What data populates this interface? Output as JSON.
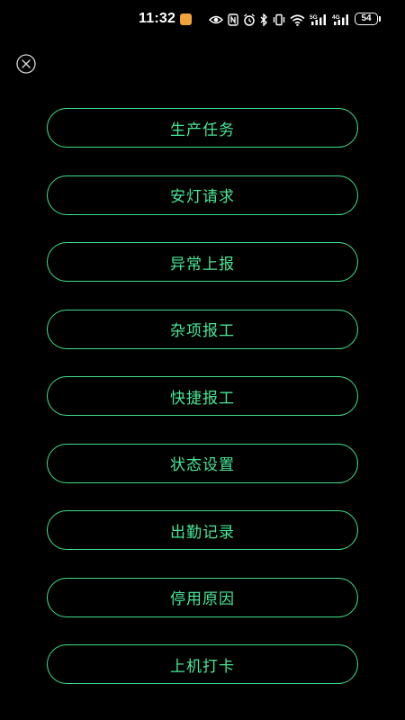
{
  "status_bar": {
    "time": "11:32",
    "battery_level": "54",
    "icons": [
      "app-notification-icon",
      "eye-icon",
      "nfc-icon",
      "alarm-icon",
      "bluetooth-icon",
      "vibrate-icon",
      "wifi-icon",
      "signal-5g-icon",
      "signal-4g-icon",
      "battery-icon"
    ]
  },
  "close_icon": "close-circle-icon",
  "colors": {
    "background": "#000000",
    "accent": "#48e696",
    "border": "#3fe08a"
  },
  "menu": {
    "items": [
      {
        "label": "生产任务"
      },
      {
        "label": "安灯请求"
      },
      {
        "label": "异常上报"
      },
      {
        "label": "杂项报工"
      },
      {
        "label": "快捷报工"
      },
      {
        "label": "状态设置"
      },
      {
        "label": "出勤记录"
      },
      {
        "label": "停用原因"
      },
      {
        "label": "上机打卡"
      }
    ]
  }
}
